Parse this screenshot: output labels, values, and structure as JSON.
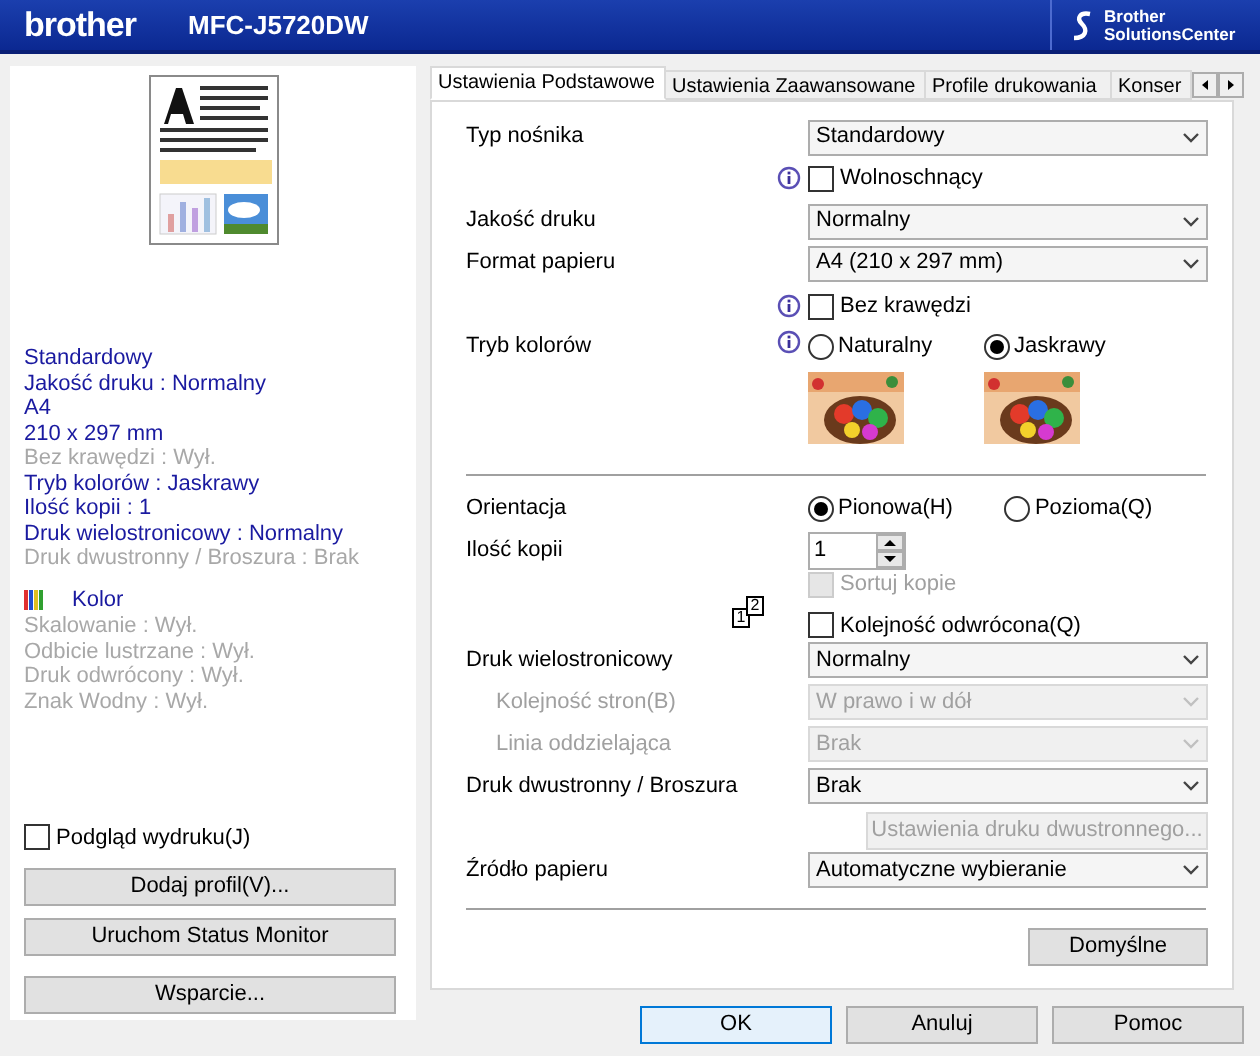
{
  "header": {
    "logo": "brother",
    "model": "MFC-J5720DW",
    "solutions_center": [
      "Brother",
      "SolutionsCenter"
    ]
  },
  "summary": [
    {
      "kind": "line",
      "text": "Standardowy",
      "enabled": true
    },
    {
      "kind": "line",
      "text": "Jakość druku : Normalny",
      "enabled": true
    },
    {
      "kind": "line",
      "text": "A4",
      "enabled": true
    },
    {
      "kind": "line",
      "text": "210 x 297 mm",
      "enabled": true
    },
    {
      "kind": "line",
      "text": "Bez krawędzi : Wył.",
      "enabled": false
    },
    {
      "kind": "line",
      "text": "Tryb kolorów : Jaskrawy",
      "enabled": true
    },
    {
      "kind": "line",
      "text": "Ilość kopii  : 1",
      "enabled": true
    },
    {
      "kind": "line",
      "text": "Druk wielostronicowy  : Normalny",
      "enabled": true
    },
    {
      "kind": "line",
      "text": "Druk dwustronny / Broszura : Brak",
      "enabled": false
    },
    {
      "kind": "color",
      "text": "Kolor",
      "enabled": true
    },
    {
      "kind": "line",
      "text": "Skalowanie : Wył.",
      "enabled": false
    },
    {
      "kind": "line",
      "text": "Odbicie lustrzane  : Wył.",
      "enabled": false
    },
    {
      "kind": "line",
      "text": "Druk odwrócony : Wył.",
      "enabled": false
    },
    {
      "kind": "line",
      "text": "Znak Wodny : Wył.",
      "enabled": false
    }
  ],
  "print_preview": {
    "label": "Podgląd wydruku(J)",
    "checked": false
  },
  "left_buttons": [
    "Dodaj profil(V)...",
    "Uruchom Status Monitor",
    "Wsparcie..."
  ],
  "tabs": [
    {
      "label": "Ustawienia Podstawowe",
      "selected": true
    },
    {
      "label": "Ustawienia Zaawansowane",
      "selected": false
    },
    {
      "label": "Profile drukowania",
      "selected": false
    },
    {
      "label": "Konser",
      "selected": false
    }
  ],
  "media_type": {
    "label": "Typ nośnika",
    "value": "Standardowy"
  },
  "slow_drying": {
    "label": "Wolnoschnący",
    "checked": false
  },
  "print_quality": {
    "label": "Jakość druku",
    "value": "Normalny"
  },
  "paper_size": {
    "label": "Format papieru",
    "value": "A4 (210 x 297 mm)"
  },
  "borderless": {
    "label": "Bez krawędzi",
    "checked": false
  },
  "color_mode": {
    "label": "Tryb kolorów",
    "options": [
      {
        "label": "Naturalny",
        "selected": false
      },
      {
        "label": "Jaskrawy",
        "selected": true
      }
    ]
  },
  "orientation": {
    "label": "Orientacja",
    "options": [
      {
        "label": "Pionowa(H)",
        "selected": true
      },
      {
        "label": "Pozioma(Q)",
        "selected": false
      }
    ]
  },
  "copies": {
    "label": "Ilość kopii",
    "value": "1",
    "icon_digits": [
      "1",
      "2"
    ]
  },
  "collate": {
    "label": "Sortuj kopie",
    "checked": false,
    "disabled": true
  },
  "reverse_order": {
    "label": "Kolejność odwrócona(Q)",
    "checked": false
  },
  "multiple_page": {
    "label": "Druk wielostronicowy",
    "value": "Normalny",
    "disabled": false
  },
  "page_order": {
    "label": "Kolejność stron(B)",
    "value": "W prawo i w dół",
    "disabled": true
  },
  "border_line": {
    "label": "Linia oddzielająca",
    "value": "Brak",
    "disabled": true
  },
  "duplex": {
    "label": "Druk dwustronny / Broszura",
    "value": "Brak",
    "disabled": false
  },
  "duplex_settings": {
    "label": "Ustawienia druku dwustronnego...",
    "disabled": true
  },
  "paper_source": {
    "label": "Źródło papieru",
    "value": "Automatyczne wybieranie",
    "disabled": false
  },
  "default_button": "Domyślne",
  "footer_buttons": [
    {
      "label": "OK",
      "default": true
    },
    {
      "label": "Anuluj",
      "default": false
    },
    {
      "label": "Pomoc",
      "default": false
    }
  ]
}
